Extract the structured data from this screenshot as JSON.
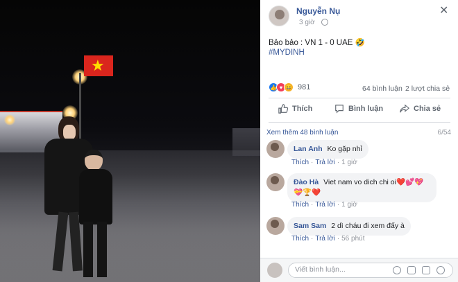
{
  "post": {
    "author": "Nguyễn Nụ",
    "time": "3 giờ",
    "text": "Bảo bảo : VN 1 - 0 UAE 🤣",
    "hashtag": "#MYDINH",
    "reactions_count": "981",
    "comments_count": "64 bình luận",
    "shares_count": "2 lượt chia sẻ"
  },
  "actions": {
    "like": "Thích",
    "comment": "Bình luận",
    "share": "Chia sẻ"
  },
  "comments_section": {
    "more_label": "Xem thêm 48 bình luận",
    "pager": "6/54",
    "like_label": "Thích",
    "reply_label": "Trả lời",
    "items": [
      {
        "name": "Lan Anh",
        "text": "Ko gặp nhỉ",
        "time": "1 giờ"
      },
      {
        "name": "Đào Hà",
        "text": "Viet nam vo dich chi oi❤️💕💖💝🏆❤️",
        "time": "1 giờ"
      },
      {
        "name": "Sam Sam",
        "text": "2 dì cháu đi xem đấy à",
        "time": "56 phút"
      }
    ]
  },
  "composer": {
    "placeholder": "Viết bình luận..."
  },
  "icons": [
    "close-icon",
    "globe-icon",
    "like-icon",
    "comment-icon",
    "share-icon",
    "emoji-icon",
    "camera-icon",
    "gif-icon",
    "sticker-icon"
  ],
  "colors": {
    "link": "#385898",
    "flag_red": "#da251d",
    "flag_star": "#ffde00"
  }
}
